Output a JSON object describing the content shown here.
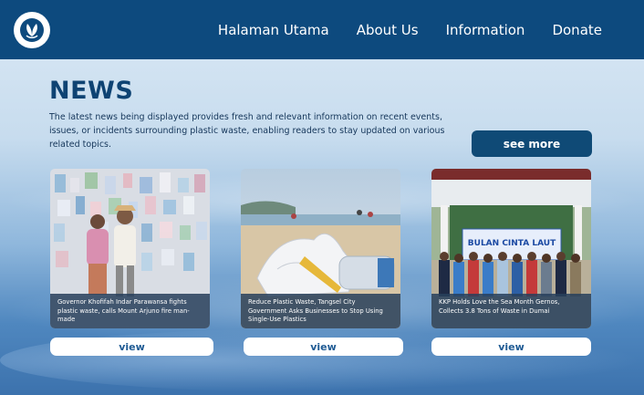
{
  "nav": {
    "items": [
      "Halaman Utama",
      "About Us",
      "Information",
      "Donate"
    ]
  },
  "icons": {
    "logo": "leaf-drop-icon"
  },
  "news": {
    "title": "NEWS",
    "description": "The latest news being displayed provides fresh and relevant information on recent events, issues, or incidents surrounding plastic waste, enabling readers to stay updated on various related topics.",
    "see_more_label": "see more"
  },
  "cards": [
    {
      "caption": "Governor Khofifah Indar Parawansa fights plastic waste, calls Mount Arjuno fire man-made",
      "button": "view"
    },
    {
      "caption": "Reduce Plastic Waste, Tangsel City Government Asks Businesses to Stop Using Single-Use Plastics",
      "button": "view"
    },
    {
      "caption": "KKP Holds Love the Sea Month Gernos, Collects 3.8 Tons of Waste in Dumai",
      "button": "view"
    }
  ],
  "banner_text": "BULAN CINTA LAUT",
  "colors": {
    "header": "#0d4a7e",
    "title": "#0e4373",
    "button": "#0f4a76"
  }
}
